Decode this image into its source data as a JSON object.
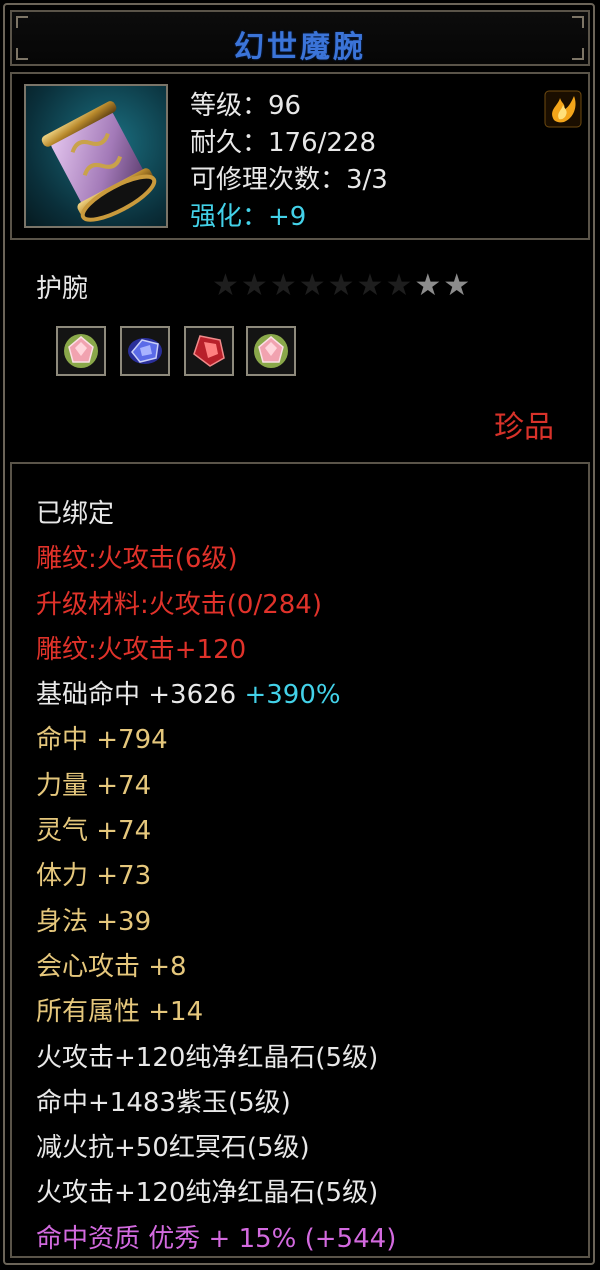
{
  "title": "幻世魔腕",
  "header": {
    "level": "等级：96",
    "durability": "耐久：176/228",
    "repair": "可修理次数：3/3",
    "enhance": "强化：+9"
  },
  "item_type": "护腕",
  "stars": {
    "total": 9,
    "filled": 2,
    "glyph": "★"
  },
  "gems": [
    "pink-gem-icon",
    "blue-gem-icon",
    "red-gem-icon",
    "pink-gem-icon"
  ],
  "quality": "珍品",
  "bound": "已绑定",
  "engrave_lines": [
    "雕纹:火攻击(6级)",
    "升级材料:火攻击(0/284)",
    "雕纹:火攻击+120"
  ],
  "base_stat": {
    "label": "基础命中  +3626",
    "bonus": "+390%"
  },
  "stats": [
    "命中  +794",
    "力量  +74",
    "灵气  +74",
    "体力  +73",
    "身法  +39",
    "会心攻击  +8",
    "所有属性  +14"
  ],
  "socket_lines": [
    "火攻击+120纯净红晶石(5级)",
    "命中+1483紫玉(5级)",
    "减火抗+50红冥石(5级)",
    "火攻击+120纯净红晶石(5级)"
  ],
  "aptitude": "命中资质 优秀 + 15% (+544)",
  "colors": {
    "title": "#3b74d8",
    "cyan": "#43d1e8",
    "red": "#e0322a",
    "yellow": "#e5c77c",
    "pink": "#d36adf"
  }
}
